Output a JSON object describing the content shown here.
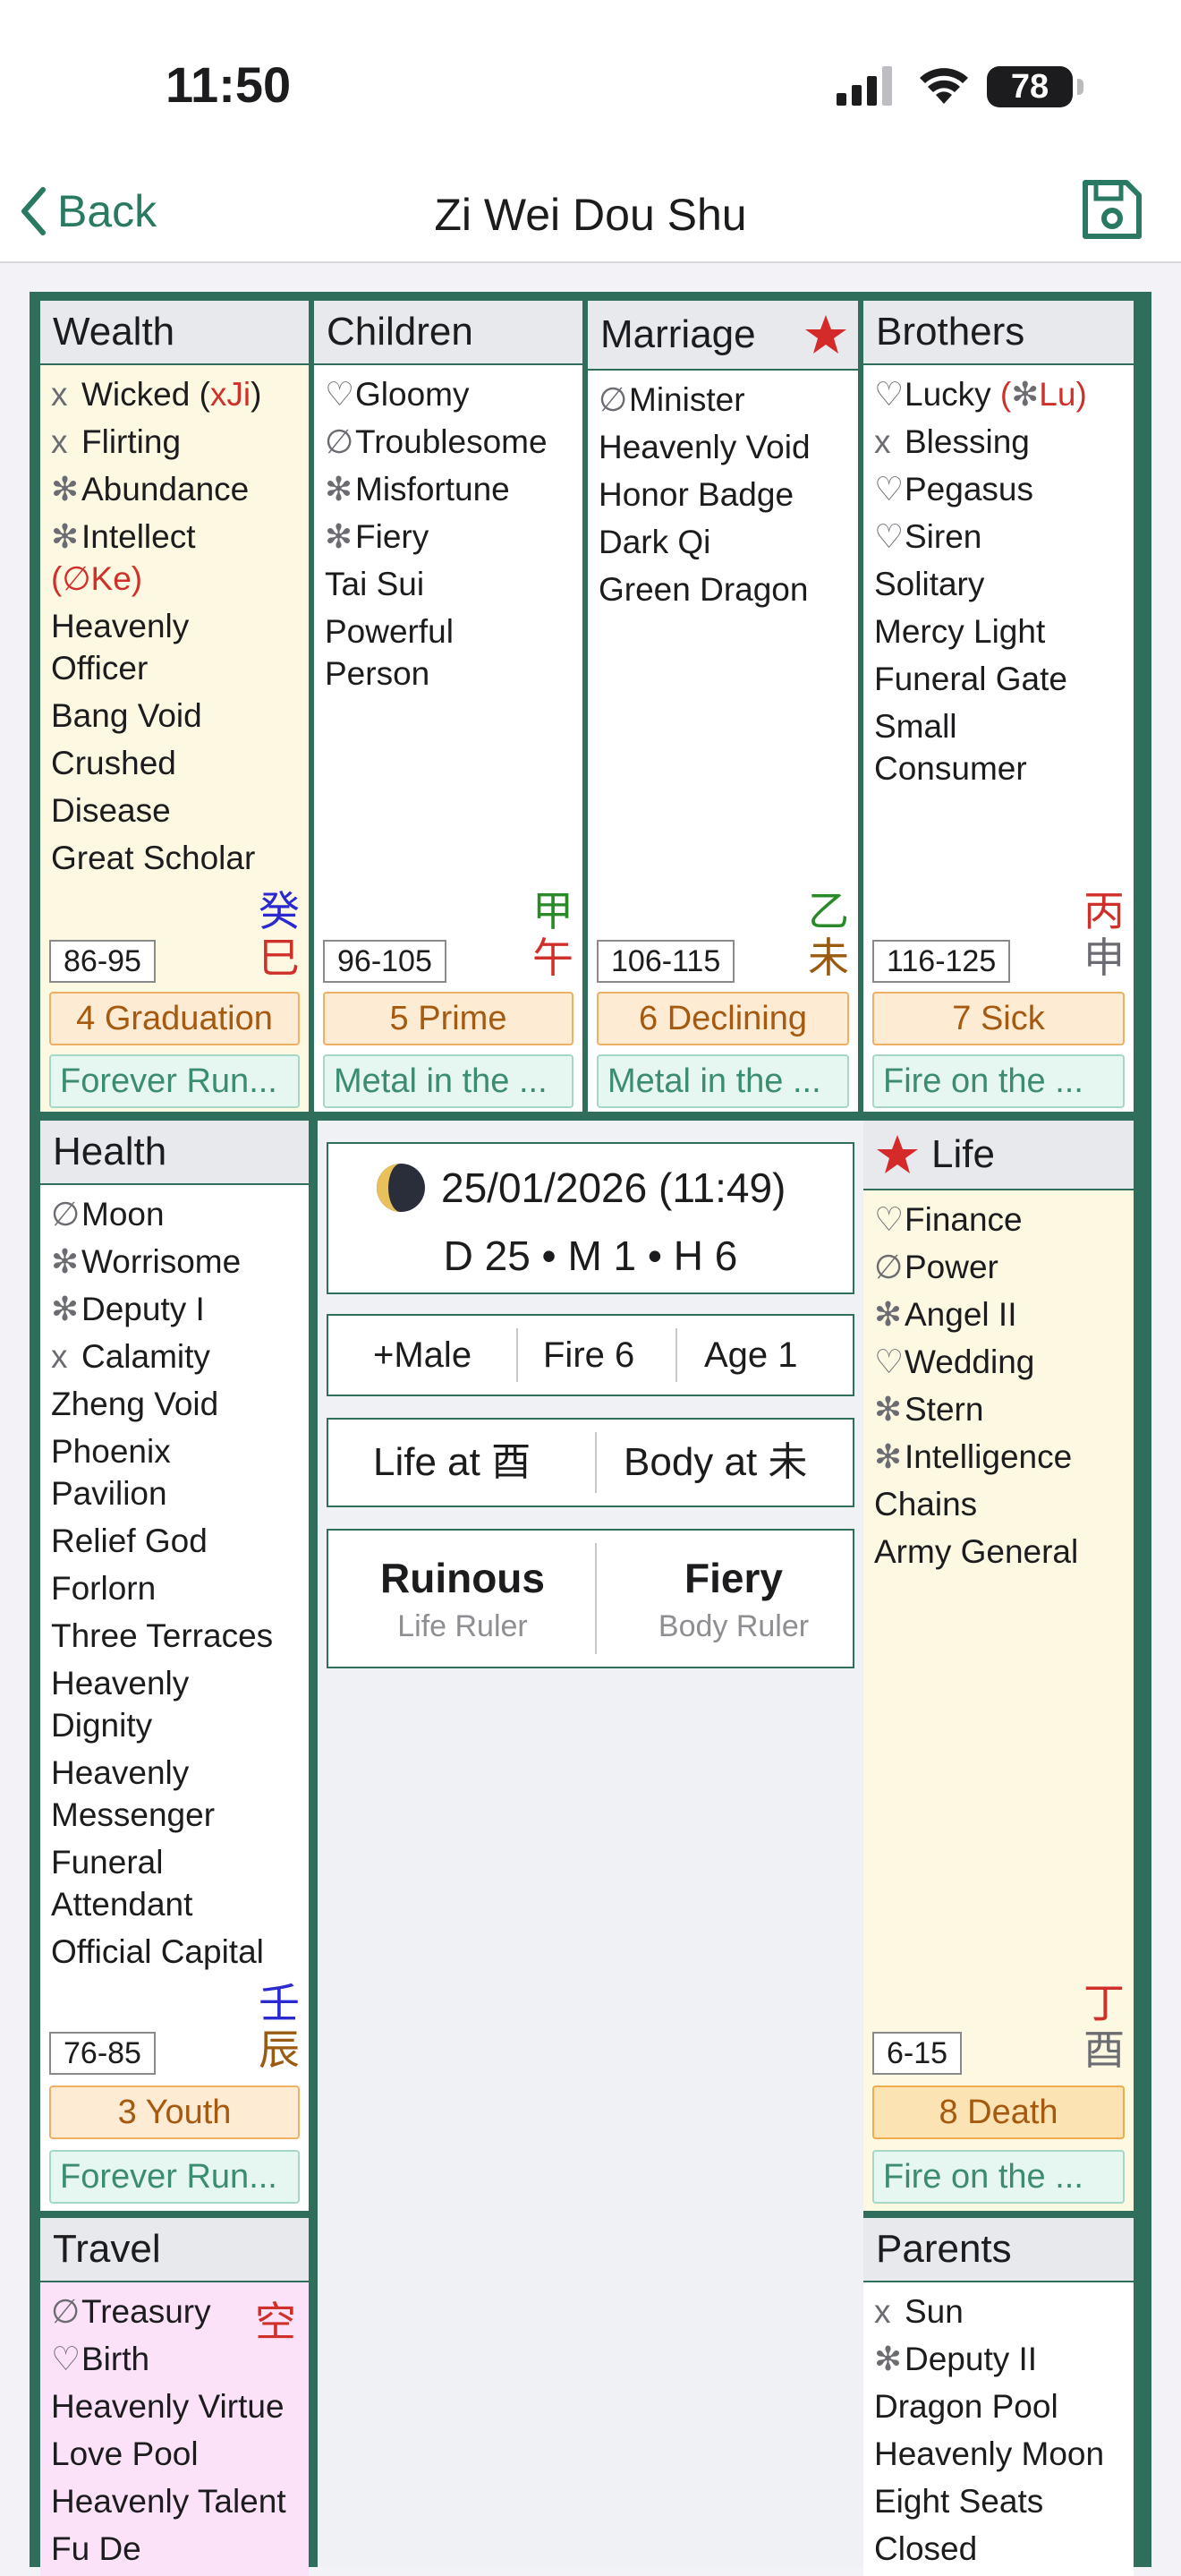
{
  "status": {
    "time": "11:50",
    "battery": "78"
  },
  "nav": {
    "back": "Back",
    "title": "Zi Wei Dou Shu"
  },
  "palaces": {
    "wealth": {
      "name": "Wealth",
      "stars": [
        {
          "mark": "x",
          "text": "Wicked",
          "note_open": " (",
          "note_mark": "x",
          "note_text": "Ji",
          "note_close": ")"
        },
        {
          "mark": "x",
          "text": "Flirting"
        },
        {
          "mark": "✻",
          "text": "Abundance"
        },
        {
          "mark": "✻",
          "text": "Intellect"
        },
        {
          "text": "Heavenly Officer"
        },
        {
          "text": "Bang Void"
        },
        {
          "text": "Crushed"
        },
        {
          "text": "Disease"
        },
        {
          "text": "Great Scholar"
        }
      ],
      "intellect_note": "(∅Ke)",
      "stem": "癸",
      "branch": "巳",
      "ages": "86-95",
      "phase": "4 Graduation",
      "element": "Forever Run..."
    },
    "children": {
      "name": "Children",
      "stars": [
        {
          "mark": "♡",
          "text": "Gloomy"
        },
        {
          "mark": "∅",
          "text": "Troublesome"
        },
        {
          "mark": "✻",
          "text": "Misfortune"
        },
        {
          "mark": "✻",
          "text": "Fiery"
        },
        {
          "text": "Tai Sui"
        },
        {
          "text": "Powerful Person"
        }
      ],
      "stem": "甲",
      "branch": "午",
      "ages": "96-105",
      "phase": "5 Prime",
      "element": "Metal in the ..."
    },
    "marriage": {
      "name": "Marriage",
      "stars": [
        {
          "mark": "∅",
          "text": "Minister"
        },
        {
          "text": "Heavenly Void"
        },
        {
          "text": "Honor Badge"
        },
        {
          "text": "Dark Qi"
        },
        {
          "text": "Green Dragon"
        }
      ],
      "stem": "乙",
      "branch": "未",
      "ages": "106-115",
      "phase": "6 Declining",
      "element": "Metal in the ..."
    },
    "brothers": {
      "name": "Brothers",
      "stars": [
        {
          "mark": "♡",
          "text": "Lucky",
          "note_open": " (",
          "note_mark": "✻",
          "note_text": "Lu",
          "note_close": ")"
        },
        {
          "mark": "x",
          "text": "Blessing"
        },
        {
          "mark": "♡",
          "text": "Pegasus"
        },
        {
          "mark": "♡",
          "text": "Siren"
        },
        {
          "text": "Solitary"
        },
        {
          "text": "Mercy Light"
        },
        {
          "text": "Funeral Gate"
        },
        {
          "text": "Small Consumer"
        }
      ],
      "stem": "丙",
      "branch": "申",
      "ages": "116-125",
      "phase": "7 Sick",
      "element": "Fire on the ..."
    },
    "health": {
      "name": "Health",
      "stars": [
        {
          "mark": "∅",
          "text": "Moon"
        },
        {
          "mark": "✻",
          "text": "Worrisome"
        },
        {
          "mark": "✻",
          "text": "Deputy I"
        },
        {
          "mark": "x",
          "text": "Calamity"
        },
        {
          "text": "Zheng Void"
        },
        {
          "text": "Phoenix Pavilion"
        },
        {
          "text": "Relief God"
        },
        {
          "text": "Forlorn"
        },
        {
          "text": "Three Terraces"
        },
        {
          "text": "Heavenly Dignity"
        },
        {
          "text": "Heavenly Messenger"
        },
        {
          "text": "Funeral Attendant"
        },
        {
          "text": "Official Capital"
        }
      ],
      "stem": "壬",
      "branch": "辰",
      "ages": "76-85",
      "phase": "3 Youth",
      "element": "Forever Run..."
    },
    "life": {
      "name": "Life",
      "stars": [
        {
          "mark": "♡",
          "text": "Finance"
        },
        {
          "mark": "∅",
          "text": "Power"
        },
        {
          "mark": "✻",
          "text": "Angel II"
        },
        {
          "mark": "♡",
          "text": "Wedding"
        },
        {
          "mark": "✻",
          "text": "Stern"
        },
        {
          "mark": "✻",
          "text": "Intelligence"
        },
        {
          "text": "Chains"
        },
        {
          "text": "Army General"
        }
      ],
      "stem": "丁",
      "branch": "酉",
      "ages": "6-15",
      "phase": "8 Death",
      "element": "Fire on the ..."
    },
    "travel": {
      "name": "Travel",
      "void": "空",
      "stars": [
        {
          "mark": "∅",
          "text": "Treasury"
        },
        {
          "mark": "♡",
          "text": "Birth"
        },
        {
          "text": "Heavenly Virtue"
        },
        {
          "text": "Love Pool"
        },
        {
          "text": "Heavenly Talent"
        },
        {
          "text": "Fu De"
        }
      ]
    },
    "parents": {
      "name": "Parents",
      "stars": [
        {
          "mark": "x",
          "text": "Sun"
        },
        {
          "mark": "✻",
          "text": "Deputy II"
        },
        {
          "text": "Dragon Pool"
        },
        {
          "text": "Heavenly Moon"
        },
        {
          "text": "Eight Seats"
        },
        {
          "text": "Closed"
        }
      ]
    }
  },
  "center": {
    "date": "25/01/2026 (11:49)",
    "dmh": "D 25 • M 1 • H 6",
    "gender": "+Male",
    "element": "Fire 6",
    "age": "Age 1",
    "life_at": "Life at 酉",
    "body_at": "Body at 未",
    "life_ruler": "Ruinous",
    "life_ruler_label": "Life Ruler",
    "body_ruler": "Fiery",
    "body_ruler_label": "Body Ruler"
  },
  "colors": {
    "frame": "#2f6e5a",
    "accent": "#2a7a63",
    "alert": "#d0302a",
    "stem_blue": "#2a2ad0",
    "stem_green": "#2a8a2a",
    "stem_red": "#d0302a",
    "stem_brown": "#9a5a10",
    "stem_gray": "#6b6b72"
  }
}
